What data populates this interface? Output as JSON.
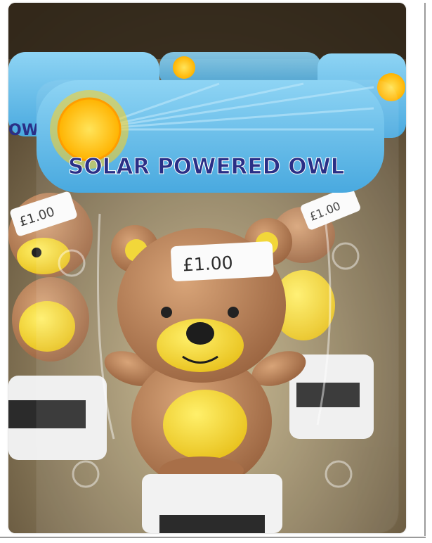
{
  "photo": {
    "header_text": "SOLAR POWERED OWL",
    "header_text_fragment": "OW",
    "price_main": "£1.00",
    "price_back_right": "£1.00",
    "price_back_left": "£1.00",
    "subject": "Brown and yellow solar-powered teddy bear toy in clear blister packaging"
  },
  "colors": {
    "header_blue": "#5cb7e6",
    "header_text": "#2a2f86",
    "sun_yellow": "#ffc21a",
    "bear_brown": "#b07a52",
    "bear_yellow": "#f2d73a",
    "base_white": "#f2f2f2",
    "solar_panel": "#2b2b2b"
  }
}
